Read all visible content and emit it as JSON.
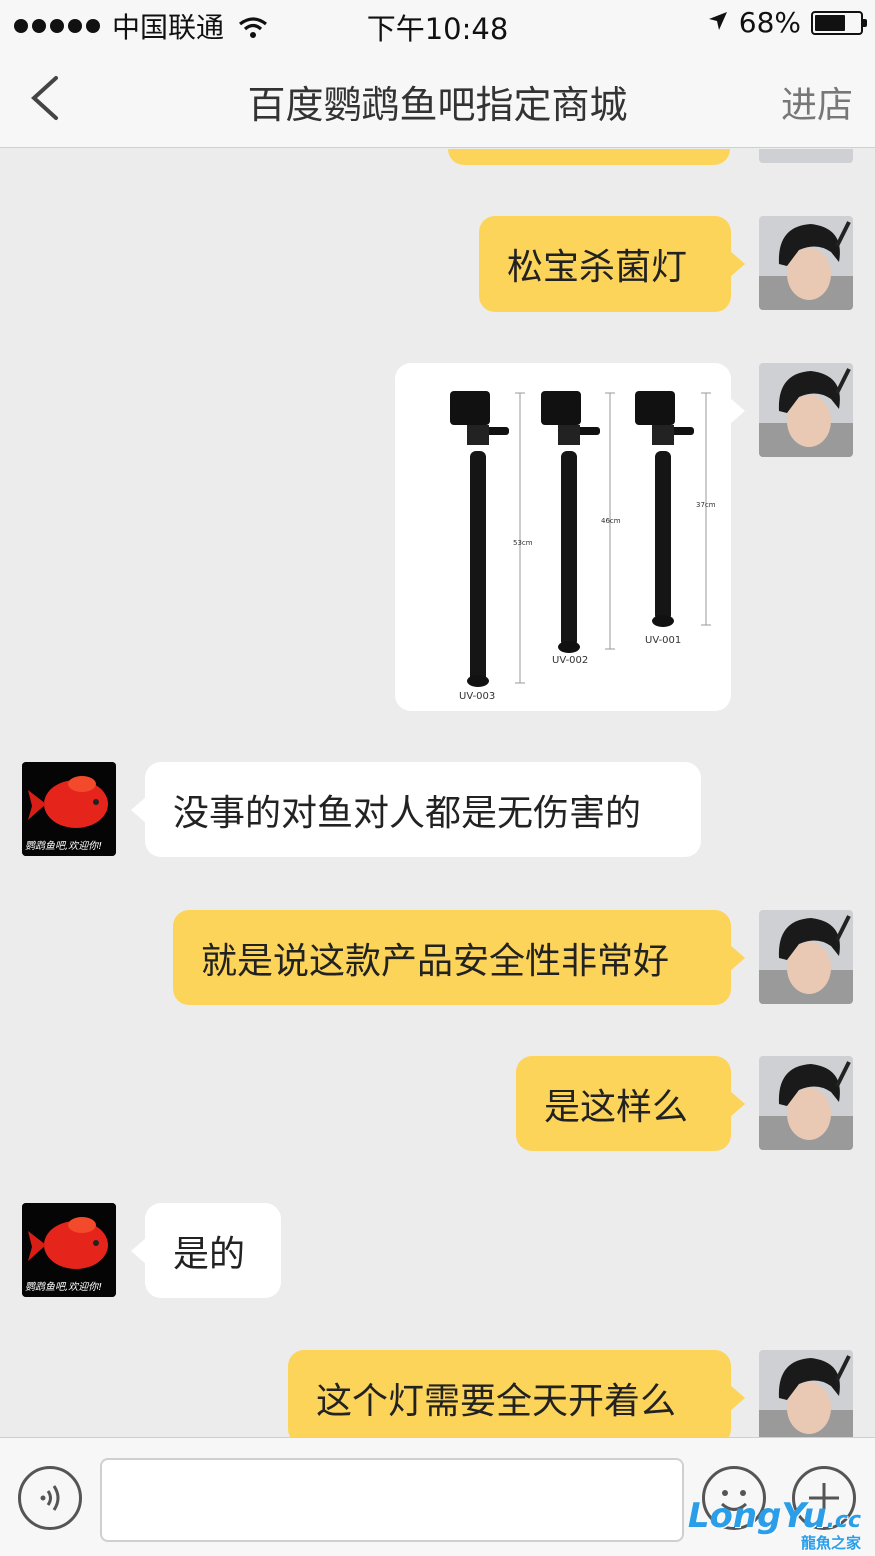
{
  "status_bar": {
    "carrier": "中国联通",
    "time": "下午10:48",
    "battery": "68%",
    "battery_level": 0.68
  },
  "nav": {
    "back_icon": "chevron-left-icon",
    "title": "百度鹦鹉鱼吧指定商城",
    "store_label": "进店"
  },
  "messages": [
    {
      "sender": "me",
      "text": "松宝杀菌灯"
    },
    {
      "sender": "me",
      "type": "image",
      "products": [
        {
          "model": "UV-003",
          "height": "53cm"
        },
        {
          "model": "UV-002",
          "height": "46cm"
        },
        {
          "model": "UV-001",
          "height": "37cm"
        }
      ]
    },
    {
      "sender": "them",
      "text": "没事的对鱼对人都是无伤害的"
    },
    {
      "sender": "me",
      "text": "就是说这款产品安全性非常好"
    },
    {
      "sender": "me",
      "text": "是这样么"
    },
    {
      "sender": "them",
      "text": "是的"
    },
    {
      "sender": "me",
      "text": "这个灯需要全天开着么"
    }
  ],
  "avatar_caption": "鹦鹉鱼吧,欢迎你!",
  "input_bar": {
    "voice_icon": "voice-icon",
    "emoji_icon": "emoji-icon",
    "plus_icon": "plus-icon"
  },
  "watermark": {
    "brand": "LongYu",
    "suffix": ".cc",
    "sub": "龍魚之家"
  }
}
